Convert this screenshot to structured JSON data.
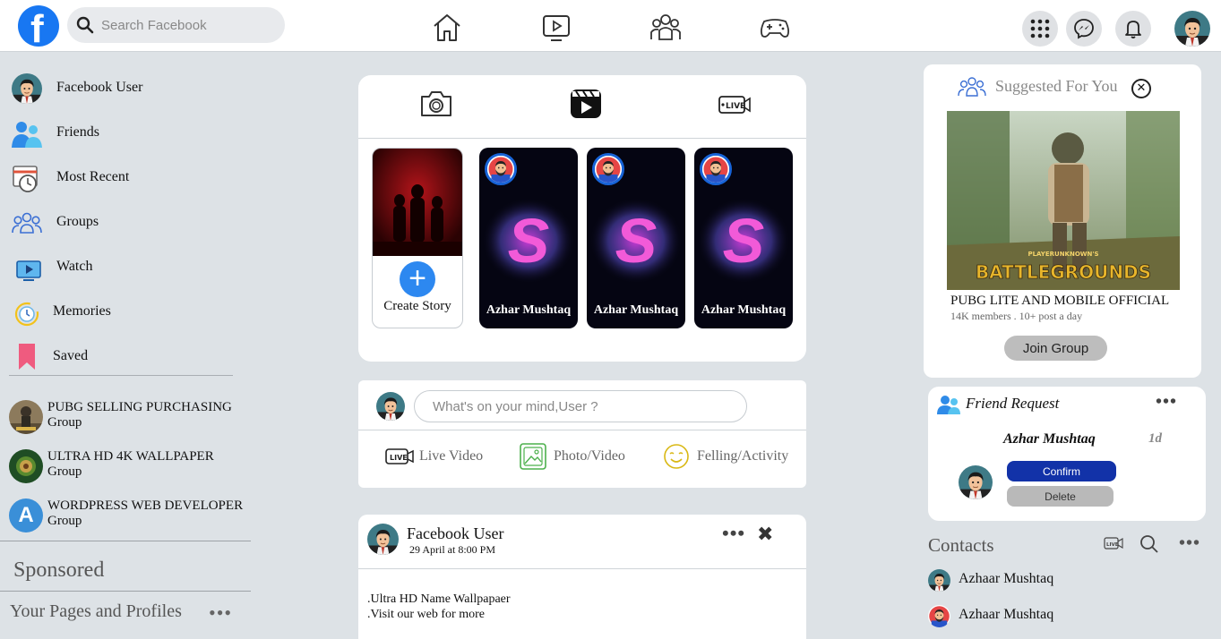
{
  "topbar": {
    "logo_letter": "f",
    "search_placeholder": "Search Facebook",
    "nav_icons": [
      "home-icon",
      "video-icon",
      "groups-icon",
      "gaming-icon"
    ],
    "right_icons": [
      "menu-grid-icon",
      "messenger-icon",
      "notifications-icon"
    ],
    "brand_color": "#1877f2"
  },
  "sidebar": {
    "menu": [
      {
        "label": "Facebook User",
        "icon": "avatar"
      },
      {
        "label": "Friends",
        "icon": "friends-icon"
      },
      {
        "label": "Most Recent",
        "icon": "most-recent-icon"
      },
      {
        "label": "Groups",
        "icon": "groups-icon"
      },
      {
        "label": "Watch",
        "icon": "watch-icon"
      },
      {
        "label": "Memories",
        "icon": "memories-icon"
      },
      {
        "label": "Saved",
        "icon": "saved-icon"
      }
    ],
    "groups": [
      {
        "name": "PUBG SELLING PURCHASING",
        "sub": "Group"
      },
      {
        "name": "ULTRA HD 4K WALLPAPER",
        "sub": "Group"
      },
      {
        "name": "WORDPRESS WEB DEVELOPER",
        "sub": "Group",
        "letter": "A"
      }
    ],
    "sponsored": "Sponsored",
    "pages_label": "Your Pages and Profiles",
    "pages_more": "•••"
  },
  "stories": {
    "tabs": [
      "camera-icon",
      "reels-icon",
      "live-icon"
    ],
    "create_label": "Create Story",
    "create_plus": "+",
    "items": [
      {
        "name": "Azhar Mushtaq",
        "letter": "S"
      },
      {
        "name": "Azhar Mushtaq",
        "letter": "S"
      },
      {
        "name": "Azhar Mushtaq",
        "letter": "S"
      }
    ]
  },
  "composer": {
    "placeholder": "What's on your mind,User ?",
    "actions": [
      {
        "label": "Live Video",
        "icon": "live-video-icon"
      },
      {
        "label": "Photo/Video",
        "icon": "photo-icon"
      },
      {
        "label": "Felling/Activity",
        "icon": "feeling-icon"
      }
    ],
    "live_badge": "LIVE"
  },
  "post": {
    "author": "Facebook User",
    "time": "29 April at 8:00 PM",
    "more": "•••",
    "close": "✖",
    "lines": [
      ".Ultra HD Name Wallpapaer",
      ".Visit our web for more"
    ]
  },
  "suggested": {
    "title": "Suggested For You",
    "close": "✕",
    "image_caption_top": "PLAYERUNKNOWN'S",
    "image_caption": "BATTLEGROUNDS",
    "group_name": "PUBG LITE AND MOBILE OFFICIAL",
    "meta": "14K members . 10+ post a day",
    "join_label": "Join Group"
  },
  "friend_request": {
    "title": "Friend Request",
    "more": "•••",
    "name": "Azhar Mushtaq",
    "time": "1d",
    "confirm": "Confirm",
    "delete": "Delete"
  },
  "contacts": {
    "title": "Contacts",
    "live_badge": "LIVE",
    "more": "•••",
    "items": [
      "Azhaar Mushtaq",
      "Azhaar Mushtaq"
    ]
  }
}
